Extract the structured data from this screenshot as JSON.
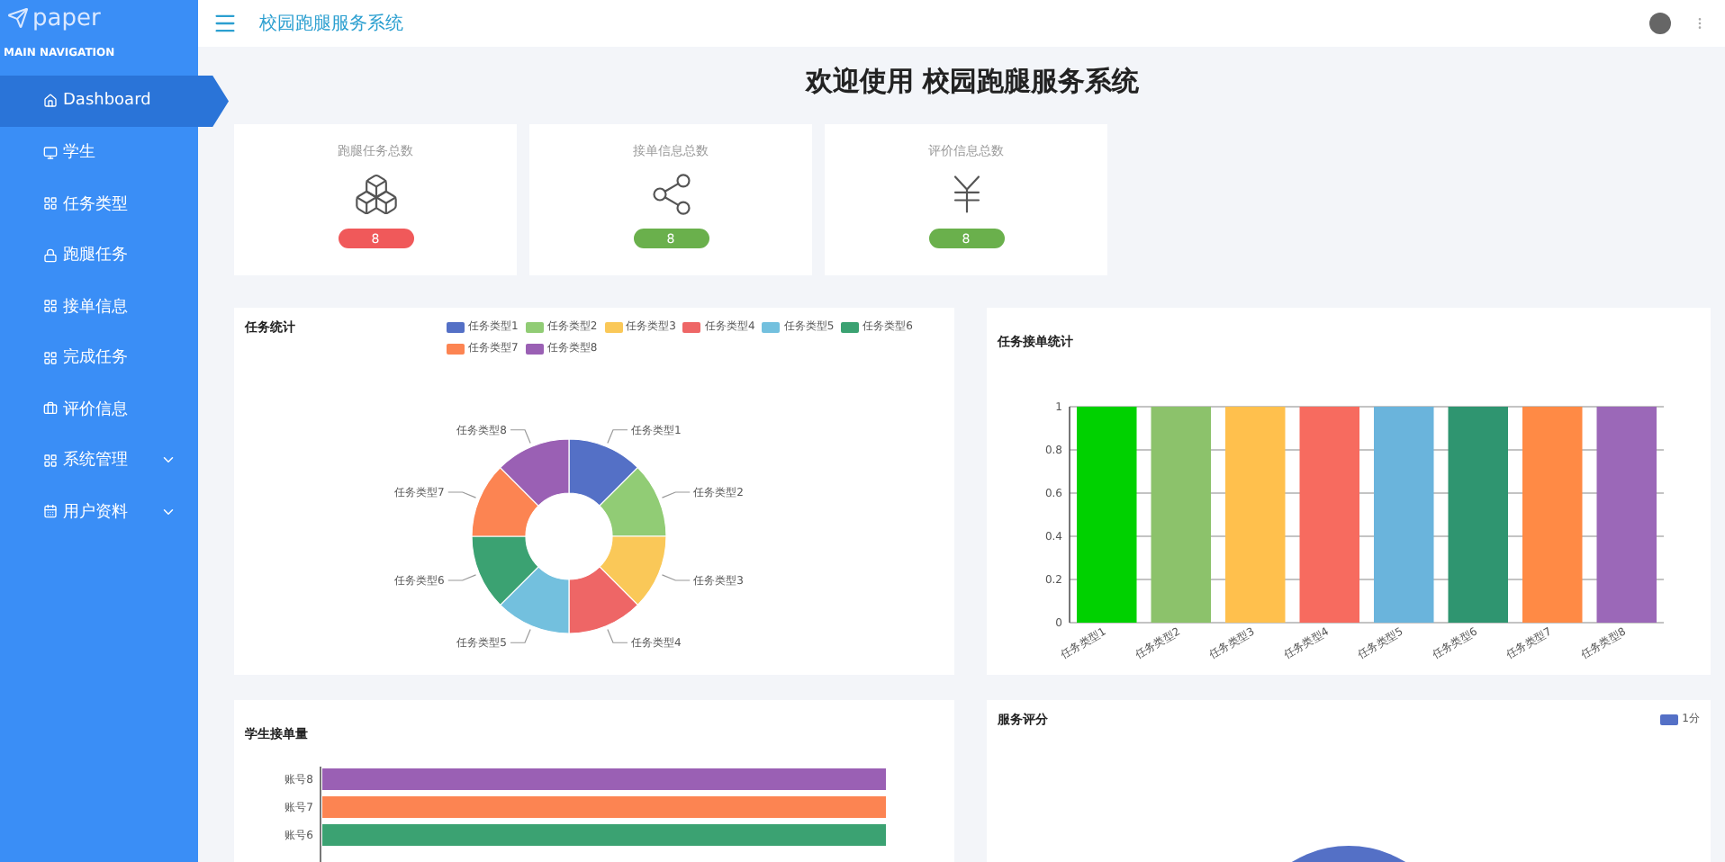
{
  "sidebar": {
    "logo": "paper",
    "section": "MAIN NAVIGATION",
    "items": [
      {
        "label": "Dashboard",
        "selected": true,
        "expandable": false
      },
      {
        "label": "学生",
        "selected": false,
        "expandable": false
      },
      {
        "label": "任务类型",
        "selected": false,
        "expandable": false
      },
      {
        "label": "跑腿任务",
        "selected": false,
        "expandable": false
      },
      {
        "label": "接单信息",
        "selected": false,
        "expandable": false
      },
      {
        "label": "完成任务",
        "selected": false,
        "expandable": false
      },
      {
        "label": "评价信息",
        "selected": false,
        "expandable": false
      },
      {
        "label": "系统管理",
        "selected": false,
        "expandable": true
      },
      {
        "label": "用户资料",
        "selected": false,
        "expandable": true
      }
    ]
  },
  "header": {
    "title": "校园跑腿服务系统"
  },
  "welcome": "欢迎使用 校园跑腿服务系统",
  "stats": [
    {
      "label": "跑腿任务总数",
      "value": "8",
      "color": "#f0595a"
    },
    {
      "label": "接单信息总数",
      "value": "8",
      "color": "#6ab04c"
    },
    {
      "label": "评价信息总数",
      "value": "8",
      "color": "#6ab04c"
    }
  ],
  "task_chart": {
    "title": "任务统计",
    "chart_data": {
      "type": "donut",
      "categories": [
        "任务类型1",
        "任务类型2",
        "任务类型3",
        "任务类型4",
        "任务类型5",
        "任务类型6",
        "任务类型7",
        "任务类型8"
      ],
      "values": [
        1,
        1,
        1,
        1,
        1,
        1,
        1,
        1
      ]
    }
  },
  "order_chart": {
    "title": "任务接单统计",
    "chart_data": {
      "type": "bar",
      "categories": [
        "任务类型1",
        "任务类型2",
        "任务类型3",
        "任务类型4",
        "任务类型5",
        "任务类型6",
        "任务类型7",
        "任务类型8"
      ],
      "values": [
        1,
        1,
        1,
        1,
        1,
        1,
        1,
        1
      ],
      "grid": true,
      "ylim": [
        0,
        1
      ],
      "yticks": [
        0,
        {
          "value": 0.2,
          "label": "0.2"
        },
        {
          "value": 0.4,
          "label": "0.4"
        },
        {
          "value": 0.6,
          "label": "0.6"
        },
        {
          "value": 0.8,
          "label": "0.8"
        },
        1
      ]
    }
  },
  "student_chart": {
    "title": "学生接单量",
    "rows": [
      {
        "label": "账号8",
        "color": "#9a60b4"
      },
      {
        "label": "账号7",
        "color": "#fc8452"
      },
      {
        "label": "账号6",
        "color": "#3ba272"
      }
    ]
  },
  "rating_chart": {
    "title": "服务评分",
    "legend": [
      {
        "label": "1分",
        "color": "#5470c6"
      }
    ]
  }
}
